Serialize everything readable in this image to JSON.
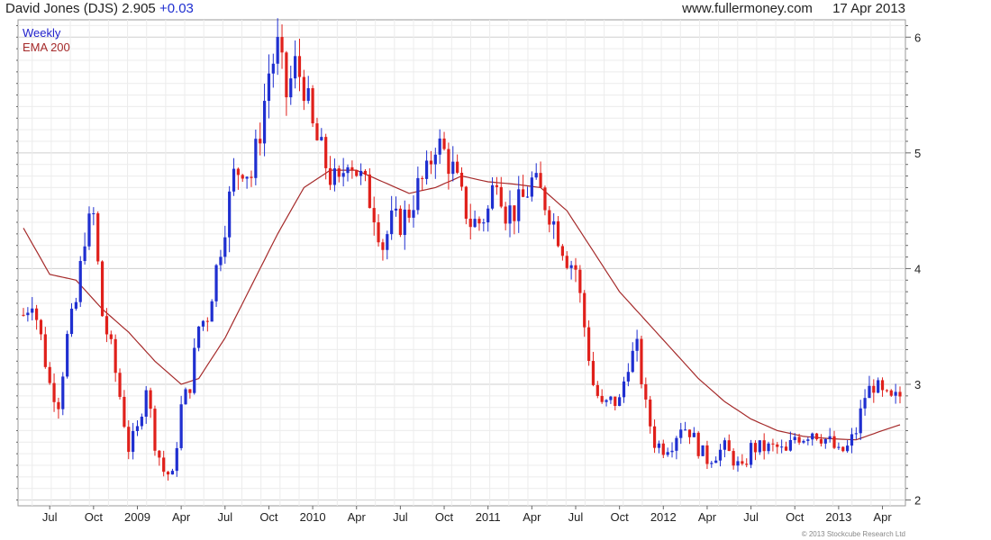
{
  "header": {
    "title": "David Jones (DJS)",
    "price": "2.905",
    "change": "+0.03",
    "site": "www.fullermoney.com",
    "date": "17 Apr 2013"
  },
  "legend": {
    "period": "Weekly",
    "ema": "EMA 200"
  },
  "copyright": "© 2013 Stockcube Research Ltd",
  "colors": {
    "up": "#1f2fd0",
    "down": "#e0201b",
    "ema": "#a52a2a",
    "grid": "#dcdcdc"
  },
  "chart_data": {
    "type": "candlestick",
    "title": "David Jones (DJS) 2.905 +0.03",
    "period": "Weekly",
    "ylim": [
      1.95,
      6.15
    ],
    "y_ticks": [
      2,
      3,
      4,
      5,
      6
    ],
    "x_tick_labels": [
      "Jul",
      "Oct",
      "2009",
      "Apr",
      "Jul",
      "Oct",
      "2010",
      "Apr",
      "Jul",
      "Oct",
      "2011",
      "Apr",
      "Jul",
      "Oct",
      "2012",
      "Apr",
      "Jul",
      "Oct",
      "2013",
      "Apr"
    ],
    "x_range_weeks": [
      0,
      200
    ],
    "x_tick_weeks": [
      6,
      16,
      26,
      36,
      46,
      56,
      66,
      76,
      86,
      96,
      106,
      116,
      126,
      136,
      146,
      156,
      166,
      176,
      186,
      196
    ],
    "price_anchors": [
      [
        0,
        3.6
      ],
      [
        2,
        3.75
      ],
      [
        4,
        3.4
      ],
      [
        6,
        3.0
      ],
      [
        8,
        2.85
      ],
      [
        10,
        3.4
      ],
      [
        12,
        3.7
      ],
      [
        14,
        4.3
      ],
      [
        16,
        4.45
      ],
      [
        18,
        3.6
      ],
      [
        20,
        3.3
      ],
      [
        22,
        2.9
      ],
      [
        24,
        2.45
      ],
      [
        26,
        2.6
      ],
      [
        28,
        3.0
      ],
      [
        30,
        2.5
      ],
      [
        32,
        2.25
      ],
      [
        34,
        2.2
      ],
      [
        36,
        2.8
      ],
      [
        38,
        3.0
      ],
      [
        40,
        3.5
      ],
      [
        42,
        3.6
      ],
      [
        44,
        4.0
      ],
      [
        46,
        4.4
      ],
      [
        48,
        4.8
      ],
      [
        50,
        4.9
      ],
      [
        52,
        4.8
      ],
      [
        54,
        5.2
      ],
      [
        56,
        5.7
      ],
      [
        58,
        5.9
      ],
      [
        60,
        5.5
      ],
      [
        62,
        5.75
      ],
      [
        64,
        5.6
      ],
      [
        66,
        5.2
      ],
      [
        68,
        5.0
      ],
      [
        70,
        4.8
      ],
      [
        72,
        4.7
      ],
      [
        74,
        5.0
      ],
      [
        76,
        4.85
      ],
      [
        78,
        4.7
      ],
      [
        80,
        4.5
      ],
      [
        82,
        4.2
      ],
      [
        84,
        4.4
      ],
      [
        86,
        4.4
      ],
      [
        88,
        4.5
      ],
      [
        90,
        4.7
      ],
      [
        92,
        4.8
      ],
      [
        94,
        5.1
      ],
      [
        96,
        5.0
      ],
      [
        98,
        4.85
      ],
      [
        100,
        4.6
      ],
      [
        102,
        4.4
      ],
      [
        104,
        4.4
      ],
      [
        106,
        4.5
      ],
      [
        108,
        4.85
      ],
      [
        110,
        4.5
      ],
      [
        112,
        4.5
      ],
      [
        114,
        4.6
      ],
      [
        116,
        4.75
      ],
      [
        118,
        4.65
      ],
      [
        120,
        4.5
      ],
      [
        122,
        4.3
      ],
      [
        124,
        4.1
      ],
      [
        126,
        4.0
      ],
      [
        128,
        3.5
      ],
      [
        130,
        3.0
      ],
      [
        132,
        2.8
      ],
      [
        134,
        2.85
      ],
      [
        136,
        2.85
      ],
      [
        138,
        3.2
      ],
      [
        140,
        3.3
      ],
      [
        142,
        2.8
      ],
      [
        144,
        2.5
      ],
      [
        146,
        2.45
      ],
      [
        148,
        2.5
      ],
      [
        150,
        2.65
      ],
      [
        152,
        2.6
      ],
      [
        154,
        2.45
      ],
      [
        156,
        2.35
      ],
      [
        158,
        2.4
      ],
      [
        160,
        2.45
      ],
      [
        162,
        2.35
      ],
      [
        164,
        2.25
      ],
      [
        166,
        2.45
      ],
      [
        168,
        2.45
      ],
      [
        170,
        2.45
      ],
      [
        172,
        2.45
      ],
      [
        174,
        2.4
      ],
      [
        176,
        2.55
      ],
      [
        178,
        2.55
      ],
      [
        180,
        2.6
      ],
      [
        182,
        2.55
      ],
      [
        184,
        2.5
      ],
      [
        186,
        2.4
      ],
      [
        188,
        2.45
      ],
      [
        190,
        2.6
      ],
      [
        192,
        2.9
      ],
      [
        194,
        3.0
      ],
      [
        196,
        2.9
      ],
      [
        198,
        2.85
      ],
      [
        200,
        2.9
      ]
    ],
    "ema_anchors": [
      [
        0,
        4.35
      ],
      [
        6,
        3.95
      ],
      [
        12,
        3.9
      ],
      [
        18,
        3.65
      ],
      [
        24,
        3.45
      ],
      [
        30,
        3.2
      ],
      [
        36,
        3.0
      ],
      [
        40,
        3.05
      ],
      [
        46,
        3.4
      ],
      [
        52,
        3.85
      ],
      [
        58,
        4.3
      ],
      [
        64,
        4.7
      ],
      [
        70,
        4.85
      ],
      [
        76,
        4.85
      ],
      [
        82,
        4.75
      ],
      [
        88,
        4.65
      ],
      [
        94,
        4.7
      ],
      [
        100,
        4.8
      ],
      [
        106,
        4.75
      ],
      [
        112,
        4.73
      ],
      [
        118,
        4.7
      ],
      [
        124,
        4.5
      ],
      [
        130,
        4.15
      ],
      [
        136,
        3.8
      ],
      [
        142,
        3.55
      ],
      [
        148,
        3.3
      ],
      [
        154,
        3.05
      ],
      [
        160,
        2.85
      ],
      [
        166,
        2.7
      ],
      [
        172,
        2.6
      ],
      [
        178,
        2.55
      ],
      [
        184,
        2.53
      ],
      [
        190,
        2.52
      ],
      [
        196,
        2.6
      ],
      [
        200,
        2.65
      ]
    ]
  }
}
